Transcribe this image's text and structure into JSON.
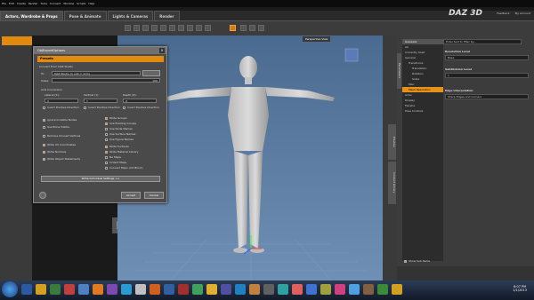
{
  "menubar": {
    "items": [
      "File",
      "Edit",
      "Create",
      "Render",
      "Tools",
      "Connect",
      "Window",
      "Scripts",
      "Help"
    ]
  },
  "tabs": [
    {
      "label": "Actors, Wardrobe & Props",
      "active": true
    },
    {
      "label": "Pose & Animate",
      "active": false
    },
    {
      "label": "Lights & Cameras",
      "active": false
    },
    {
      "label": "Render",
      "active": false
    }
  ],
  "brand": {
    "logo": "DAZ 3D",
    "links": [
      "Feedback",
      "My Account"
    ]
  },
  "viewport": {
    "label": "Perspective View"
  },
  "right_panel": {
    "search_placeholder": "Enter text to filter by...",
    "tree": [
      "Genesis",
      "All",
      "Currently Used",
      "General",
      "Transforms",
      "Translation",
      "Rotation",
      "Scale",
      "Misc",
      "Mesh Resolution",
      "Actor",
      "Display",
      "Morphs",
      "Pose Controls"
    ],
    "selected": "Mesh Resolution",
    "props": [
      {
        "label": "Resolution Level",
        "value": "Base"
      },
      {
        "label": "SubDivision Level",
        "value": "1"
      },
      {
        "label": "Edge Interpolation",
        "value": "Sharp Edges and Corners"
      }
    ],
    "side_tabs": [
      "Parameters",
      "Content Library",
      "Preview"
    ],
    "show_sub_items": "Show Sub Items"
  },
  "dialog": {
    "title": "ObjExportOptions",
    "preset": "Presets",
    "convert_label": "Convert From DAZ Studio",
    "to_label": "To:",
    "to_value": "DAZ Studio (1 unit = 1cm)",
    "scale_label": "Scale:",
    "scale_value": "100",
    "axis_label": "Axis Conversion",
    "lateral": "Lateral (X):",
    "vertical": "Vertical (Y):",
    "depth": "Depth (Z):",
    "x_val": "X",
    "y_val": "Y",
    "z_val": "Z",
    "invert_x": "Invert Positive Direction",
    "invert_y": "Invert Positive Direction",
    "invert_z": "Invert Positive Direction",
    "left_opts": [
      "Ignore Invisible Nodes",
      "Use Bone Visible",
      "Remove Unused Vertices",
      "Write UV Coordinates",
      "Write Normals",
      "Write Object Statements"
    ],
    "right_opts": [
      "Write Groups",
      "Use Existing Groups",
      "Use Node Names",
      "Use Surface Names",
      "Use Figure Names",
      "Write Surfaces",
      "Write Material Library",
      "No Maps",
      "Collect Maps",
      "Convert Maps (Art Block)"
    ],
    "individual": "Write Individual Settings >>",
    "accept": "Accept",
    "cancel": "Cancel"
  },
  "taskbar": {
    "time": "8:07 PM",
    "date": "1/1/2013"
  }
}
